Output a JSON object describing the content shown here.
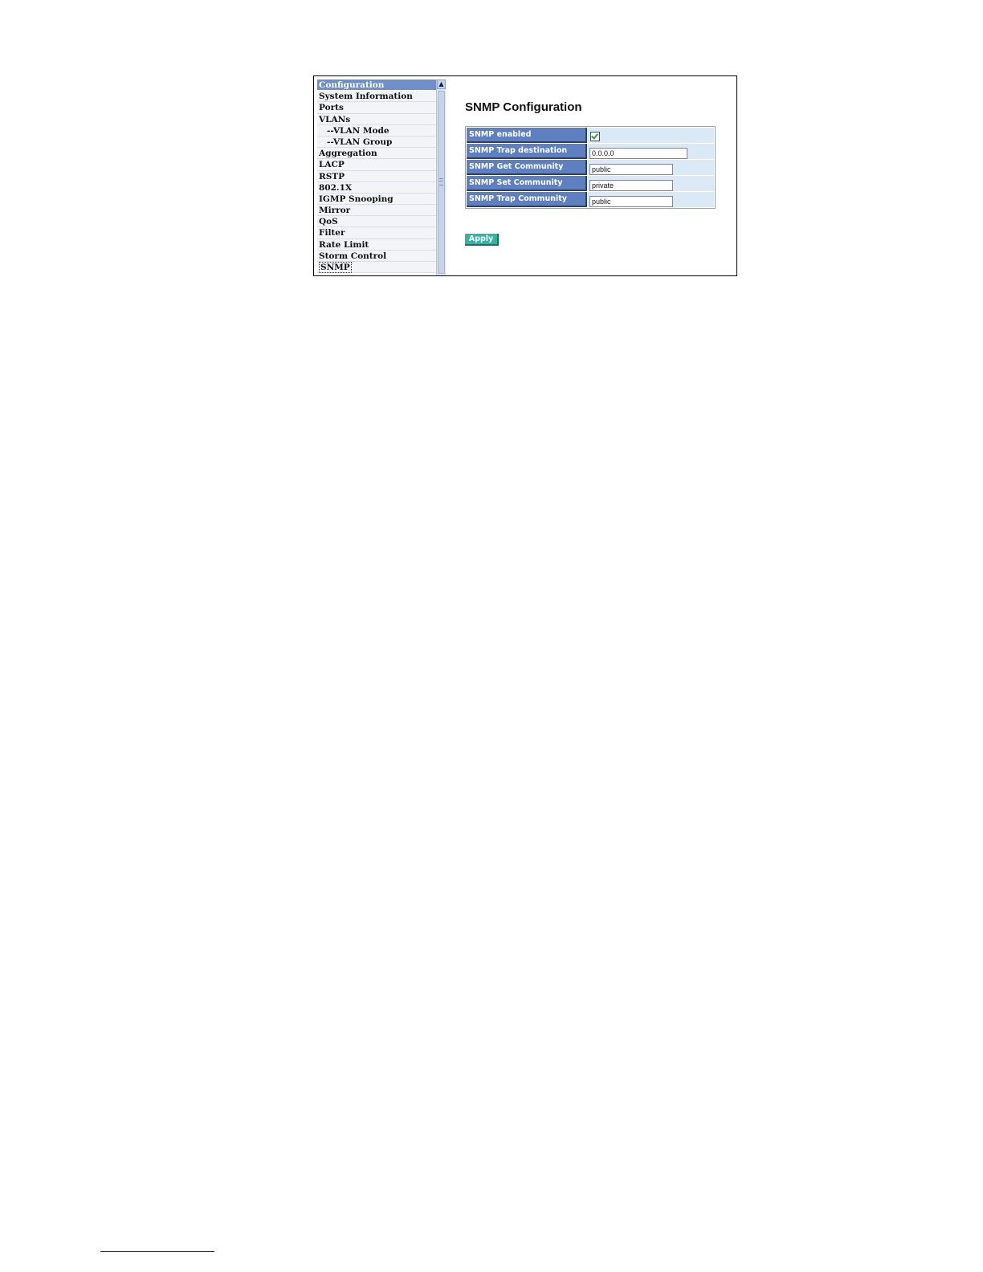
{
  "sidebar": {
    "header": "Configuration",
    "items": [
      {
        "label": "System Information"
      },
      {
        "label": "Ports"
      },
      {
        "label": "VLANs"
      },
      {
        "label": "--VLAN Mode"
      },
      {
        "label": "--VLAN Group"
      },
      {
        "label": "Aggregation"
      },
      {
        "label": "LACP"
      },
      {
        "label": "RSTP"
      },
      {
        "label": "802.1X"
      },
      {
        "label": "IGMP Snooping"
      },
      {
        "label": "Mirror"
      },
      {
        "label": "QoS"
      },
      {
        "label": "Filter"
      },
      {
        "label": "Rate Limit"
      },
      {
        "label": "Storm Control"
      },
      {
        "label": "SNMP"
      }
    ],
    "selected": "SNMP"
  },
  "main": {
    "title": "SNMP Configuration",
    "fields": [
      {
        "label": "SNMP enabled",
        "type": "checkbox",
        "checked": true
      },
      {
        "label": "SNMP Trap destination",
        "type": "text",
        "value": "0.0.0.0"
      },
      {
        "label": "SNMP Get Community",
        "type": "text",
        "value": "public"
      },
      {
        "label": "SNMP Set Community",
        "type": "text",
        "value": "private"
      },
      {
        "label": "SNMP Trap Community",
        "type": "text",
        "value": "public"
      }
    ],
    "apply_label": "Apply"
  },
  "colors": {
    "header_blue": "#6f8fc8",
    "label_blue": "#5f80c0",
    "value_bg": "#dbe9f7",
    "apply_teal": "#33b4a4"
  },
  "icons": {
    "scroll_up": "chevron-up-icon",
    "checkbox": "check-icon"
  }
}
